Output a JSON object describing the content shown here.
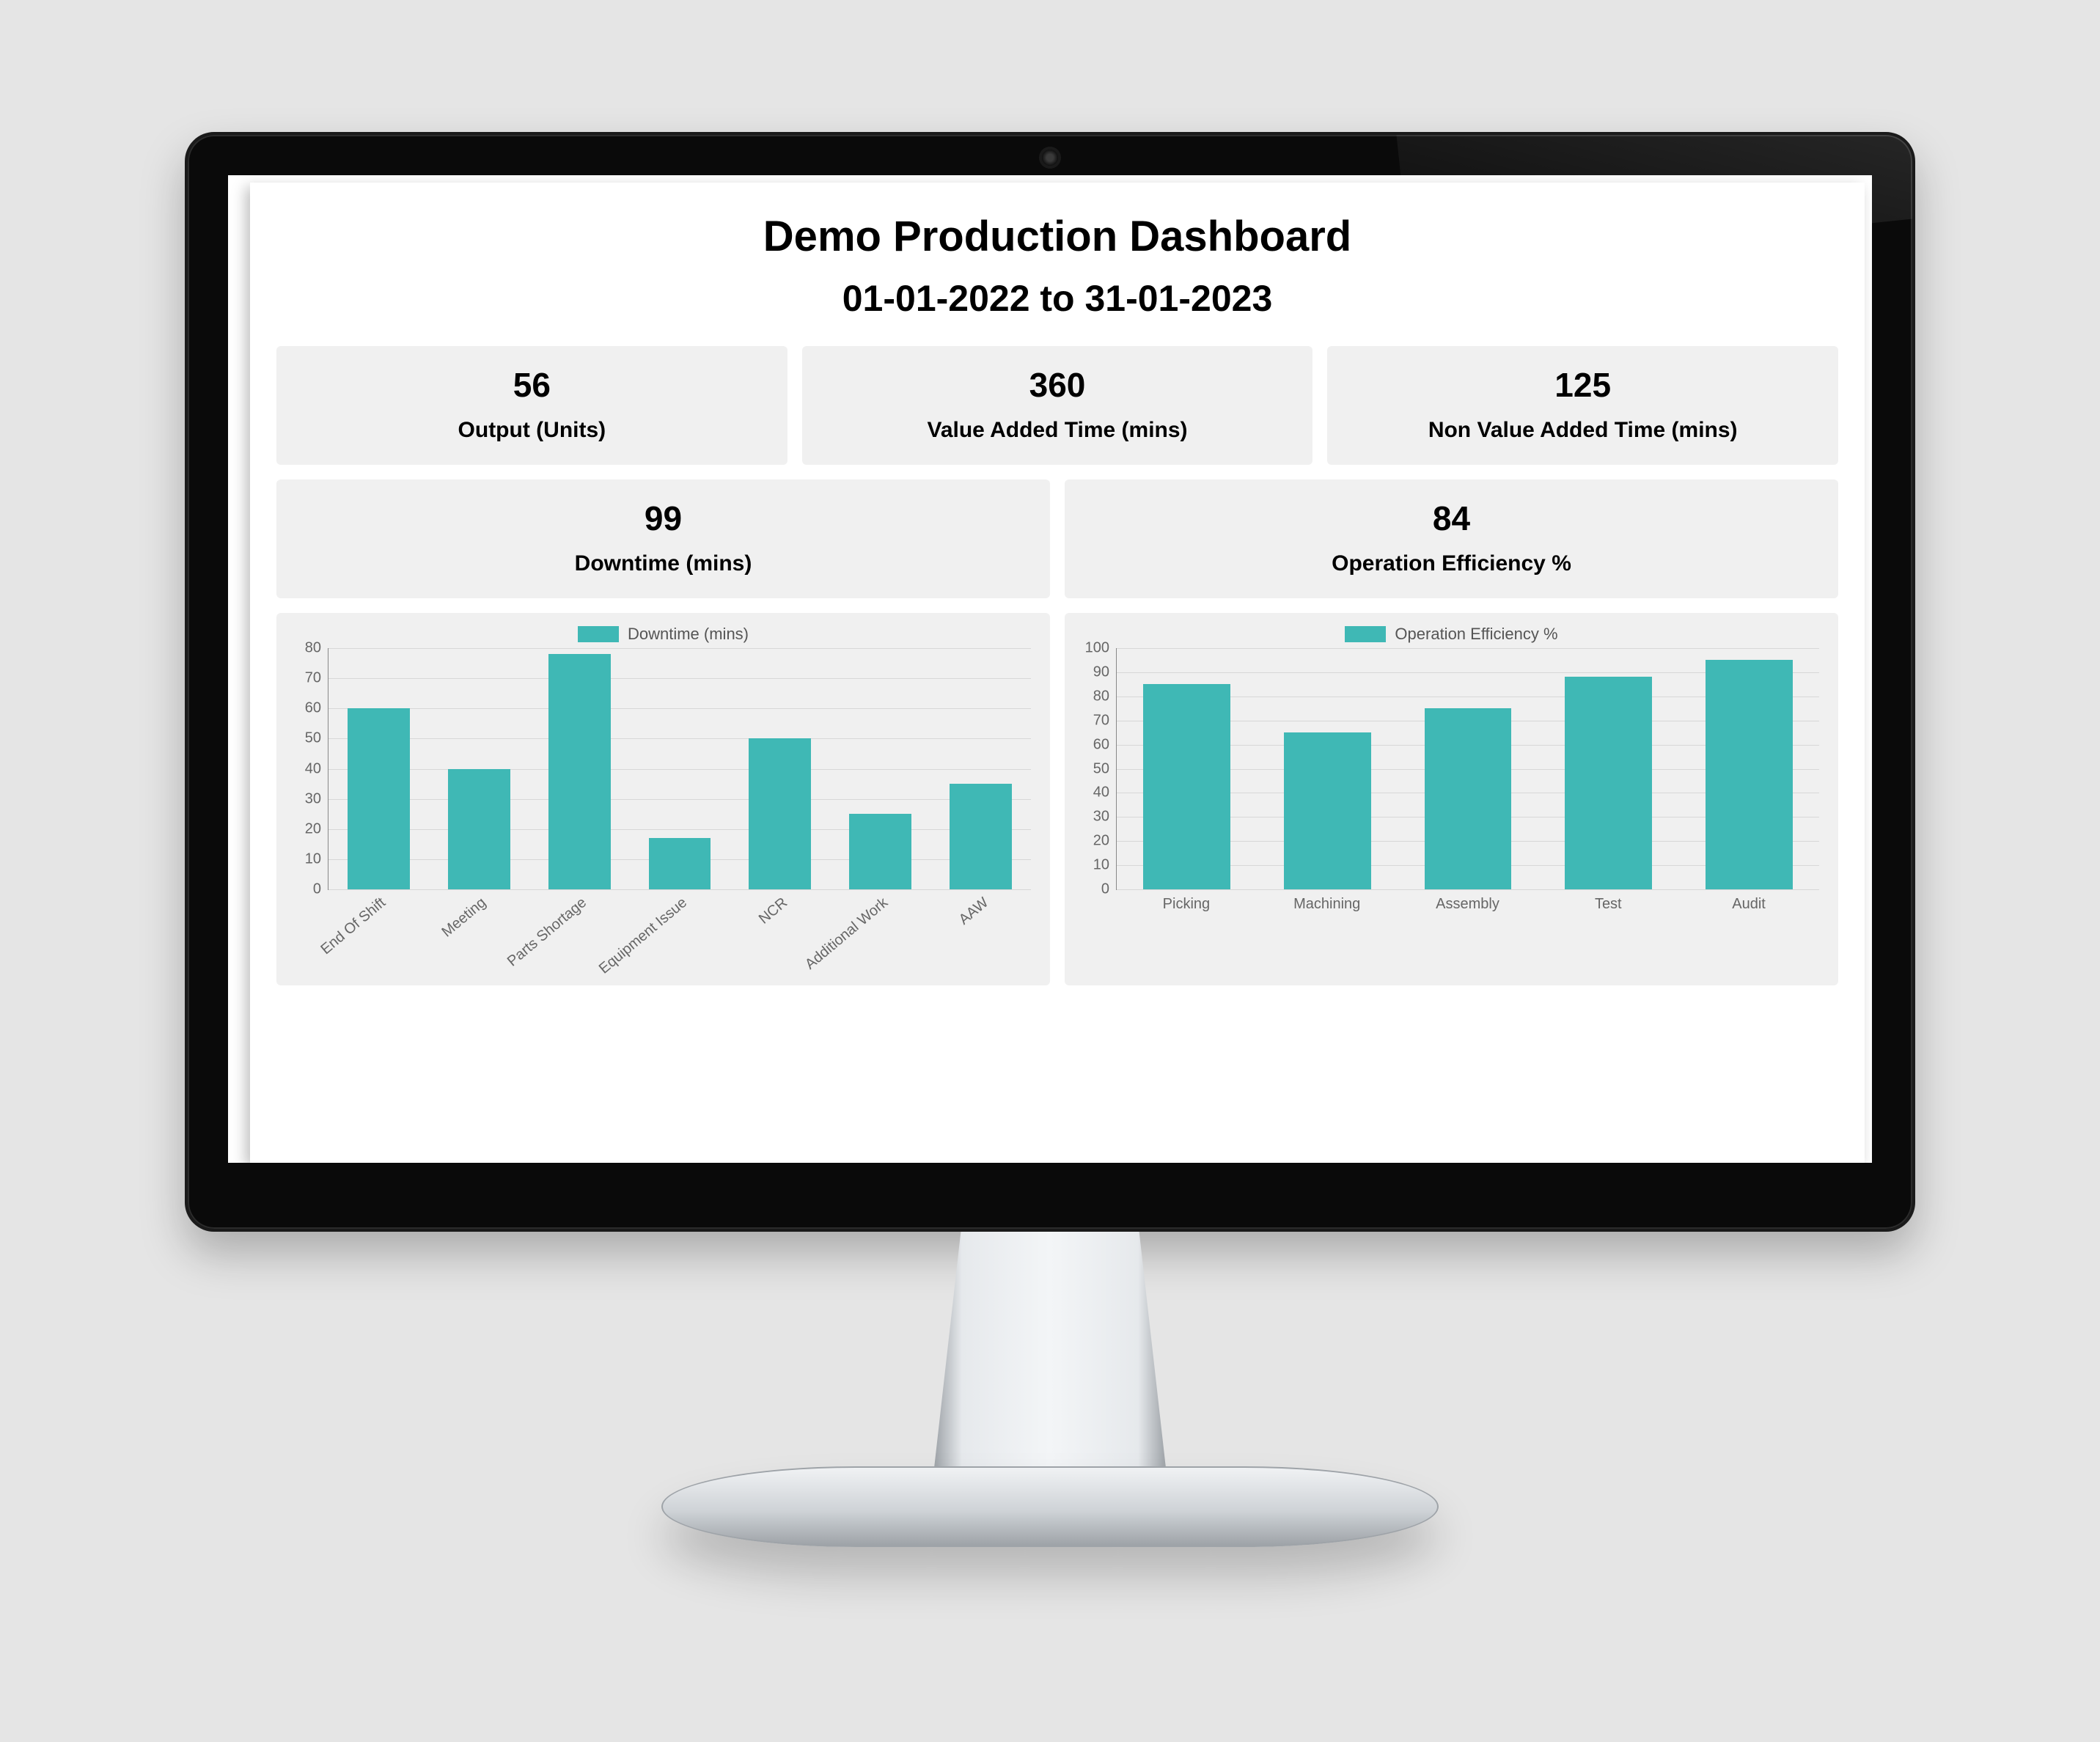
{
  "dashboard": {
    "title": "Demo Production Dashboard",
    "subtitle": "01-01-2022 to 31-01-2023"
  },
  "kpis_row1": [
    {
      "value": "56",
      "label": "Output (Units)"
    },
    {
      "value": "360",
      "label": "Value Added Time (mins)"
    },
    {
      "value": "125",
      "label": "Non Value Added Time (mins)"
    }
  ],
  "kpis_row2": [
    {
      "value": "99",
      "label": "Downtime (mins)"
    },
    {
      "value": "84",
      "label": "Operation Efficiency %"
    }
  ],
  "charts": {
    "downtime": {
      "legend": "Downtime (mins)"
    },
    "efficiency": {
      "legend": "Operation Efficiency %"
    }
  },
  "chart_data": [
    {
      "type": "bar",
      "title": "Downtime (mins)",
      "xlabel": "",
      "ylabel": "",
      "ylim": [
        0,
        80
      ],
      "ytick_step": 10,
      "categories": [
        "End Of Shift",
        "Meeting",
        "Parts Shortage",
        "Equipment Issue",
        "NCR",
        "Additional Work",
        "AAW"
      ],
      "values": [
        60,
        40,
        78,
        17,
        50,
        25,
        35
      ],
      "color": "#3fb8b5",
      "x_rotated": true
    },
    {
      "type": "bar",
      "title": "Operation Efficiency %",
      "xlabel": "",
      "ylabel": "",
      "ylim": [
        0,
        100
      ],
      "ytick_step": 10,
      "categories": [
        "Picking",
        "Machining",
        "Assembly",
        "Test",
        "Audit"
      ],
      "values": [
        85,
        65,
        75,
        88,
        95
      ],
      "color": "#3fb8b5",
      "x_rotated": false
    }
  ]
}
